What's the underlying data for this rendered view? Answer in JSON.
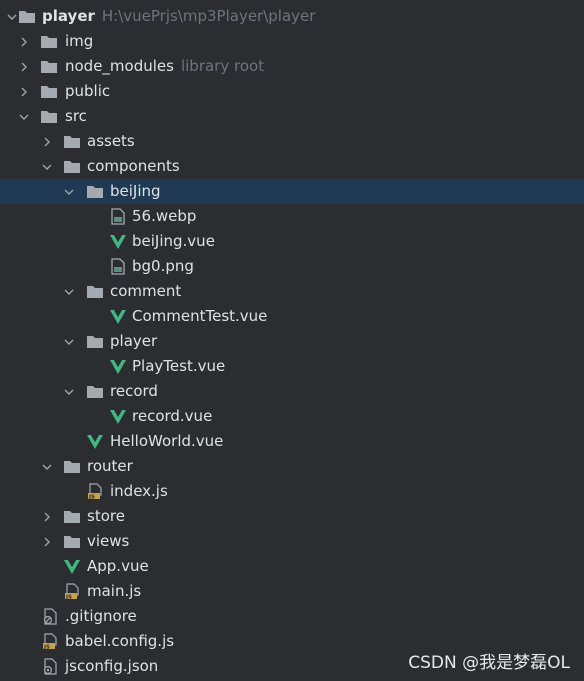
{
  "project_tree": {
    "root": {
      "name": "player",
      "path": "H:\\vuePrjs\\mp3Player\\player"
    },
    "img": {
      "name": "img"
    },
    "node_modules": {
      "name": "node_modules",
      "hint": "library root"
    },
    "public": {
      "name": "public"
    },
    "src": {
      "name": "src"
    },
    "assets": {
      "name": "assets"
    },
    "components": {
      "name": "components"
    },
    "beijing": {
      "name": "beiJing"
    },
    "f_56webp": {
      "name": "56.webp"
    },
    "f_beijingvue": {
      "name": "beiJing.vue"
    },
    "f_bg0png": {
      "name": "bg0.png"
    },
    "comment": {
      "name": "comment"
    },
    "f_commenttest": {
      "name": "CommentTest.vue"
    },
    "player": {
      "name": "player"
    },
    "f_playtest": {
      "name": "PlayTest.vue"
    },
    "record": {
      "name": "record"
    },
    "f_recordvue": {
      "name": "record.vue"
    },
    "f_helloworld": {
      "name": "HelloWorld.vue"
    },
    "router": {
      "name": "router"
    },
    "f_indexjs": {
      "name": "index.js"
    },
    "store": {
      "name": "store"
    },
    "views": {
      "name": "views"
    },
    "f_appvue": {
      "name": "App.vue"
    },
    "f_mainjs": {
      "name": "main.js"
    },
    "f_gitignore": {
      "name": ".gitignore"
    },
    "f_babelconfig": {
      "name": "babel.config.js"
    },
    "f_jsconfig": {
      "name": "jsconfig.json"
    }
  },
  "colors": {
    "background": "#2b2d30",
    "selection": "#1f3a52",
    "folder": "#a5a9b0",
    "vue": "#41b883",
    "js_badge": "#c7a24b",
    "hint_text": "#6f737a"
  },
  "watermark": "CSDN @我是梦磊OL"
}
